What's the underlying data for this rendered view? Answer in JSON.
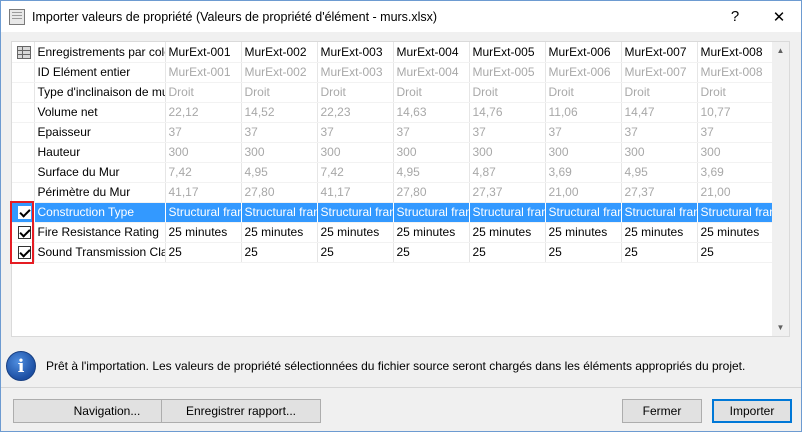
{
  "window": {
    "title": "Importer valeurs de propriété (Valeurs de propriété d'élément - murs.xlsx)",
    "help": "?",
    "close": "✕"
  },
  "grid": {
    "header_label": "Enregistrements par colonne",
    "columns": [
      "MurExt-001",
      "MurExt-002",
      "MurExt-003",
      "MurExt-004",
      "MurExt-005",
      "MurExt-006",
      "MurExt-007",
      "MurExt-008"
    ],
    "rows": [
      {
        "label": "ID Elément entier",
        "checked": null,
        "dim": true,
        "selected": false,
        "values": [
          "MurExt-001",
          "MurExt-002",
          "MurExt-003",
          "MurExt-004",
          "MurExt-005",
          "MurExt-006",
          "MurExt-007",
          "MurExt-008"
        ]
      },
      {
        "label": "Type d'inclinaison de mur",
        "checked": null,
        "dim": true,
        "selected": false,
        "values": [
          "Droit",
          "Droit",
          "Droit",
          "Droit",
          "Droit",
          "Droit",
          "Droit",
          "Droit"
        ]
      },
      {
        "label": "Volume net",
        "checked": null,
        "dim": true,
        "selected": false,
        "values": [
          "22,12",
          "14,52",
          "22,23",
          "14,63",
          "14,76",
          "11,06",
          "14,47",
          "10,77"
        ]
      },
      {
        "label": "Epaisseur",
        "checked": null,
        "dim": true,
        "selected": false,
        "values": [
          "37",
          "37",
          "37",
          "37",
          "37",
          "37",
          "37",
          "37"
        ]
      },
      {
        "label": "Hauteur",
        "checked": null,
        "dim": true,
        "selected": false,
        "values": [
          "300",
          "300",
          "300",
          "300",
          "300",
          "300",
          "300",
          "300"
        ]
      },
      {
        "label": "Surface du Mur",
        "checked": null,
        "dim": true,
        "selected": false,
        "values": [
          "7,42",
          "4,95",
          "7,42",
          "4,95",
          "4,87",
          "3,69",
          "4,95",
          "3,69"
        ]
      },
      {
        "label": "Périmètre du Mur",
        "checked": null,
        "dim": true,
        "selected": false,
        "values": [
          "41,17",
          "27,80",
          "41,17",
          "27,80",
          "27,37",
          "21,00",
          "27,37",
          "21,00"
        ]
      },
      {
        "label": "Construction Type",
        "checked": true,
        "dim": false,
        "selected": true,
        "values": [
          "Structural frame",
          "Structural frame",
          "Structural frame",
          "Structural frame",
          "Structural frame",
          "Structural frame",
          "Structural frame",
          "Structural frame"
        ]
      },
      {
        "label": "Fire Resistance Rating",
        "checked": true,
        "dim": false,
        "selected": false,
        "values": [
          "25 minutes",
          "25 minutes",
          "25 minutes",
          "25 minutes",
          "25 minutes",
          "25 minutes",
          "25 minutes",
          "25 minutes"
        ]
      },
      {
        "label": "Sound Transmission Class",
        "checked": true,
        "dim": false,
        "selected": false,
        "values": [
          "25",
          "25",
          "25",
          "25",
          "25",
          "25",
          "25",
          "25"
        ]
      }
    ]
  },
  "status": {
    "icon": "info-icon",
    "text": "Prêt à l'importation. Les valeurs de propriété sélectionnées du fichier source seront chargés dans les éléments appropriés du projet."
  },
  "buttons": {
    "navigation": "Navigation...",
    "save_report": "Enregistrer rapport...",
    "close": "Fermer",
    "import": "Importer"
  }
}
